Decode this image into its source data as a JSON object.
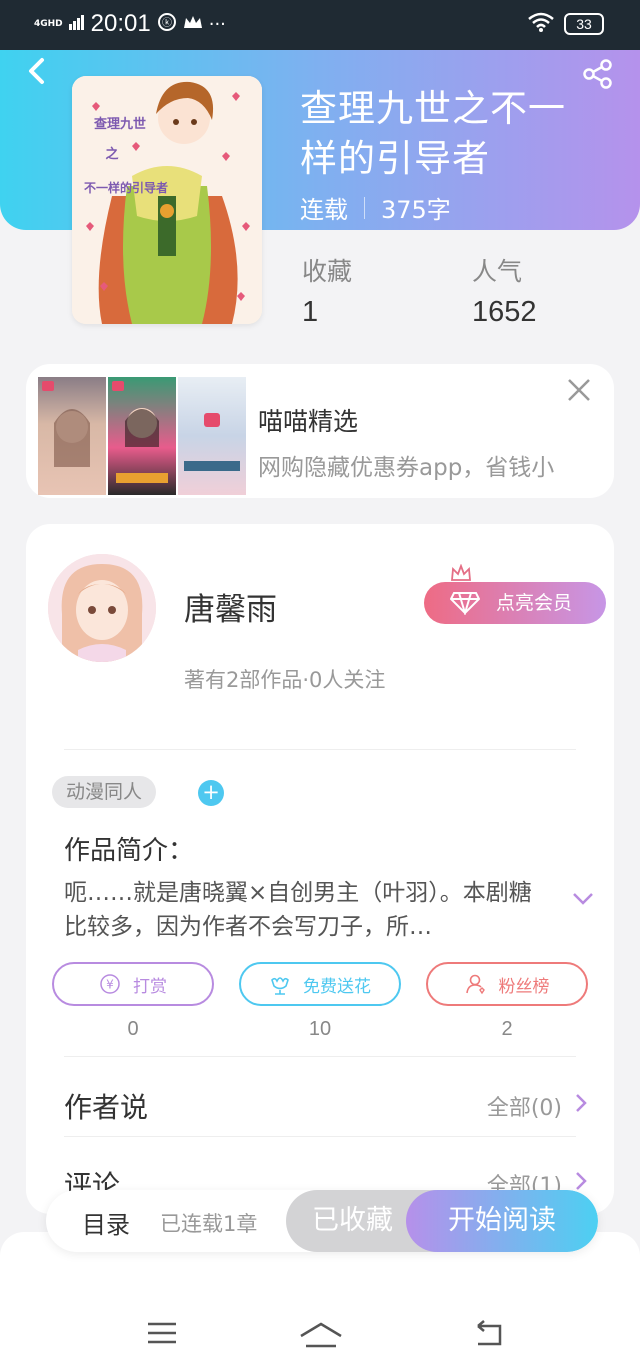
{
  "status_bar": {
    "network": "4GHD",
    "time": "20:01",
    "battery": "33",
    "icons": [
      "signal-icon",
      "notification-icon",
      "crown-icon",
      "more-icon",
      "wifi-icon",
      "battery-icon"
    ]
  },
  "header": {
    "back_icon": "back-arrow-icon",
    "share_icon": "share-icon",
    "cover_text_line1": "查理九世",
    "cover_text_line2": "之",
    "cover_text_line3": "不一样的引导者"
  },
  "book": {
    "title": "查理九世之不一样的引导者",
    "status": "连载",
    "words": "375字",
    "favorites_label": "收藏",
    "favorites_value": "1",
    "popularity_label": "人气",
    "popularity_value": "1652"
  },
  "ad": {
    "title": "喵喵精选",
    "description": "网购隐藏优惠券app，省钱小",
    "close_icon": "close-icon"
  },
  "author": {
    "name": "唐馨雨",
    "subtitle": "著有2部作品·0人关注",
    "vip_label": "点亮会员"
  },
  "tags": {
    "genre": "动漫同人",
    "add": "+"
  },
  "intro": {
    "heading": "作品简介：",
    "text": "呃……就是唐晓翼×自创男主（叶羽）。本剧糖比较多，因为作者不会写刀子，所…"
  },
  "actions": [
    {
      "label": "打赏",
      "count": "0",
      "icon": "yen-coin-icon",
      "color": "#b88be0"
    },
    {
      "label": "免费送花",
      "count": "10",
      "icon": "flower-icon",
      "color": "#4ec8f0"
    },
    {
      "label": "粉丝榜",
      "count": "2",
      "icon": "fans-icon",
      "color": "#ee7a7a"
    }
  ],
  "sections": {
    "author_says": "作者说",
    "author_says_all": "全部(0)",
    "comments": "评论",
    "comments_all": "全部(1)"
  },
  "bottom_bar": {
    "toc": "目录",
    "chapters": "已连载1章",
    "favorited": "已收藏",
    "start_reading": "开始阅读"
  },
  "colors": {
    "gradient_start": "#3fd2f0",
    "gradient_end": "#b592ec",
    "vip_start": "#ee6b84",
    "vip_end": "#c796e6"
  }
}
